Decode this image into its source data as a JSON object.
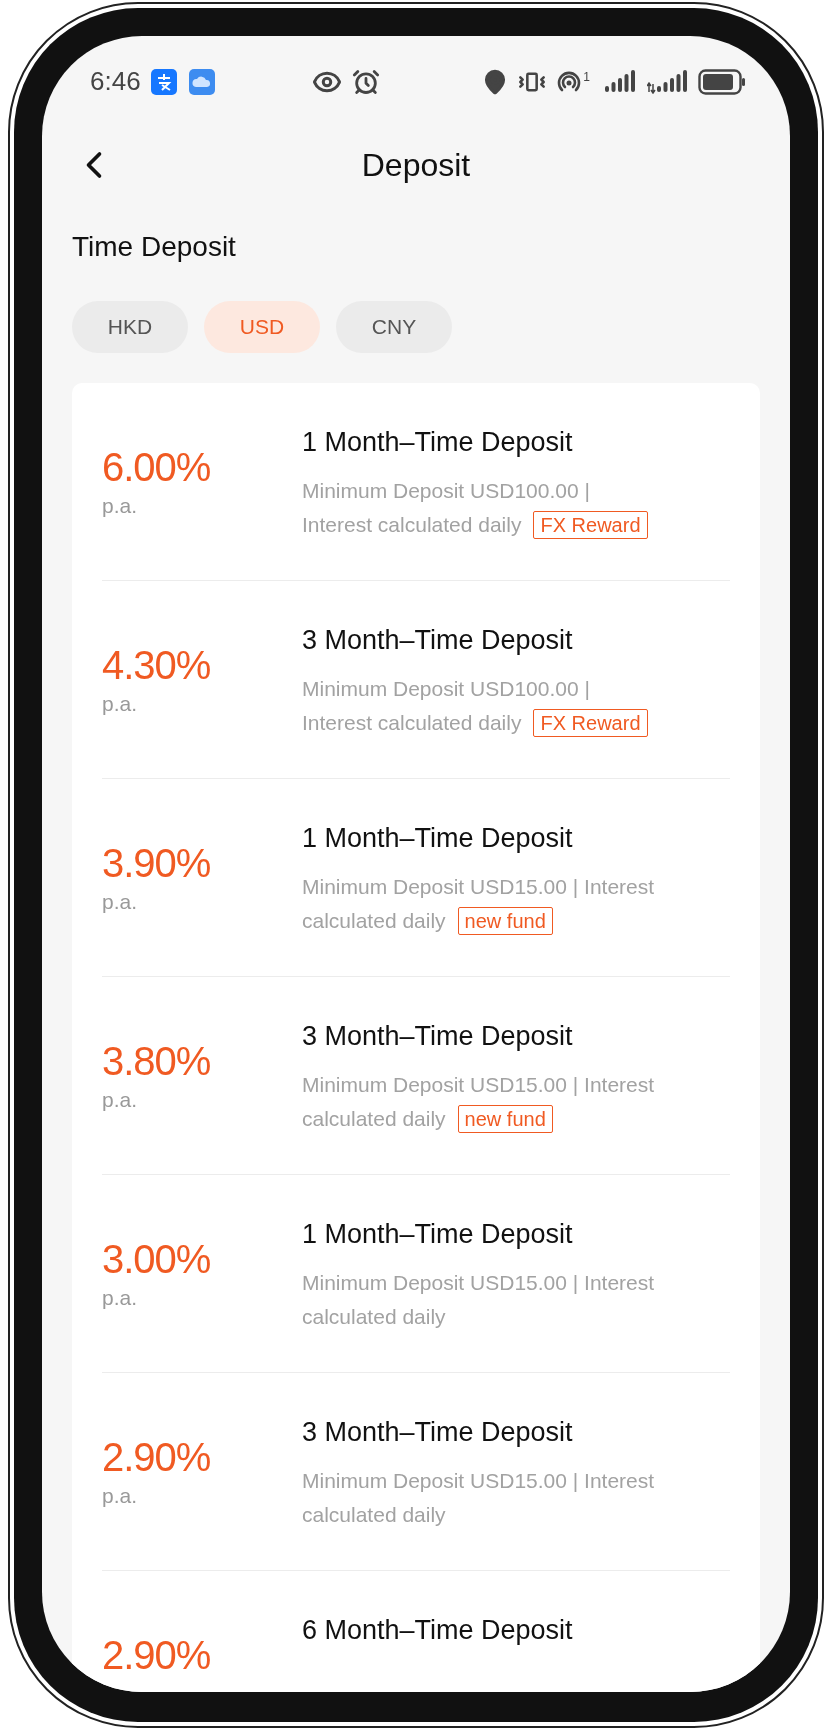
{
  "status_bar": {
    "time": "6:46",
    "hotspot_count": "1"
  },
  "header": {
    "title": "Deposit"
  },
  "section_title": "Time Deposit",
  "currency_tabs": [
    {
      "label": "HKD",
      "selected": false
    },
    {
      "label": "USD",
      "selected": true
    },
    {
      "label": "CNY",
      "selected": false
    }
  ],
  "deposits": [
    {
      "rate": "6.00%",
      "unit": "p.a.",
      "title": "1 Month–Time Deposit",
      "description": [
        "Minimum Deposit USD100.00 |",
        "Interest calculated daily"
      ],
      "tag": "FX Reward"
    },
    {
      "rate": "4.30%",
      "unit": "p.a.",
      "title": "3 Month–Time Deposit",
      "description": [
        "Minimum Deposit USD100.00 |",
        "Interest calculated daily"
      ],
      "tag": "FX Reward"
    },
    {
      "rate": "3.90%",
      "unit": "p.a.",
      "title": "1 Month–Time Deposit",
      "description": [
        "Minimum Deposit USD15.00 | Interest",
        "calculated daily"
      ],
      "tag": "new fund"
    },
    {
      "rate": "3.80%",
      "unit": "p.a.",
      "title": "3 Month–Time Deposit",
      "description": [
        "Minimum Deposit USD15.00 | Interest",
        "calculated daily"
      ],
      "tag": "new fund"
    },
    {
      "rate": "3.00%",
      "unit": "p.a.",
      "title": "1 Month–Time Deposit",
      "description": [
        "Minimum Deposit USD15.00 | Interest",
        "calculated daily"
      ]
    },
    {
      "rate": "2.90%",
      "unit": "p.a.",
      "title": "3 Month–Time Deposit",
      "description": [
        "Minimum Deposit USD15.00 | Interest",
        "calculated daily"
      ]
    },
    {
      "rate": "2.90%",
      "title": "6 Month–Time Deposit"
    }
  ]
}
